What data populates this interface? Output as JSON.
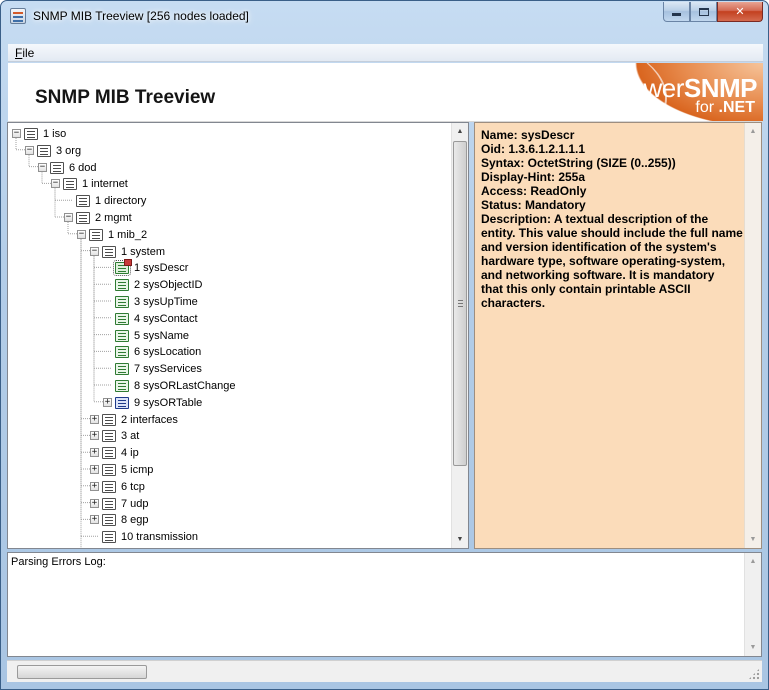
{
  "window": {
    "title": "SNMP MIB Treeview  [256 nodes loaded]",
    "controls": {
      "minimize_icon": "minimize-icon",
      "maximize_icon": "maximize-icon",
      "close_icon": "close-icon"
    }
  },
  "menu": {
    "file_prefix": "F",
    "file_rest": "ile"
  },
  "banner": {
    "title": "SNMP MIB Treeview",
    "logo_power": "power",
    "logo_snmp": "SNMP",
    "logo_for": "for ",
    "logo_net": ".NET",
    "logo_colors": {
      "orange": "#d9651f",
      "white": "#ffffff"
    }
  },
  "tree": {
    "nodes": [
      {
        "label": "1 iso",
        "icon": "folder-node-icon",
        "expander": "−"
      },
      {
        "label": "3 org",
        "icon": "folder-node-icon",
        "expander": "−"
      },
      {
        "label": "6 dod",
        "icon": "folder-node-icon",
        "expander": "−"
      },
      {
        "label": "1 internet",
        "icon": "folder-node-icon",
        "expander": "−"
      },
      {
        "label": "1 directory",
        "icon": "folder-node-icon",
        "expander": ""
      },
      {
        "label": "2 mgmt",
        "icon": "folder-node-icon",
        "expander": "−"
      },
      {
        "label": "1 mib_2",
        "icon": "folder-node-icon",
        "expander": "−"
      },
      {
        "label": "1 system",
        "icon": "folder-node-icon",
        "expander": "−"
      },
      {
        "label": "1 sysDescr",
        "icon": "scalar-node-icon",
        "expander": "",
        "selected": true
      },
      {
        "label": "2 sysObjectID",
        "icon": "scalar-node-icon",
        "expander": ""
      },
      {
        "label": "3 sysUpTime",
        "icon": "scalar-node-icon",
        "expander": ""
      },
      {
        "label": "4 sysContact",
        "icon": "scalar-node-icon",
        "expander": ""
      },
      {
        "label": "5 sysName",
        "icon": "scalar-node-icon",
        "expander": ""
      },
      {
        "label": "6 sysLocation",
        "icon": "scalar-node-icon",
        "expander": ""
      },
      {
        "label": "7 sysServices",
        "icon": "scalar-node-icon",
        "expander": ""
      },
      {
        "label": "8 sysORLastChange",
        "icon": "scalar-node-icon",
        "expander": ""
      },
      {
        "label": "9 sysORTable",
        "icon": "table-node-icon",
        "expander": "+"
      },
      {
        "label": "2 interfaces",
        "icon": "folder-node-icon",
        "expander": "+"
      },
      {
        "label": "3 at",
        "icon": "folder-node-icon",
        "expander": "+"
      },
      {
        "label": "4 ip",
        "icon": "folder-node-icon",
        "expander": "+"
      },
      {
        "label": "5 icmp",
        "icon": "folder-node-icon",
        "expander": "+"
      },
      {
        "label": "6 tcp",
        "icon": "folder-node-icon",
        "expander": "+"
      },
      {
        "label": "7 udp",
        "icon": "folder-node-icon",
        "expander": "+"
      },
      {
        "label": "8 egp",
        "icon": "folder-node-icon",
        "expander": "+"
      },
      {
        "label": "10 transmission",
        "icon": "folder-node-icon",
        "expander": ""
      }
    ]
  },
  "detail": {
    "background_color": "#fbdcba",
    "lines": [
      "Name: sysDescr",
      "Oid: 1.3.6.1.2.1.1.1",
      "Syntax: OctetString (SIZE (0..255))",
      "Display-Hint: 255a",
      "Access: ReadOnly",
      "Status: Mandatory",
      "Description: A textual description of the",
      "entity. This value should include the full name",
      "and version identification of the system's",
      "hardware type, software operating-system,",
      "and networking software. It is mandatory",
      "that this only contain printable ASCII",
      "characters."
    ]
  },
  "errors_log": {
    "label": "Parsing Errors Log:"
  }
}
